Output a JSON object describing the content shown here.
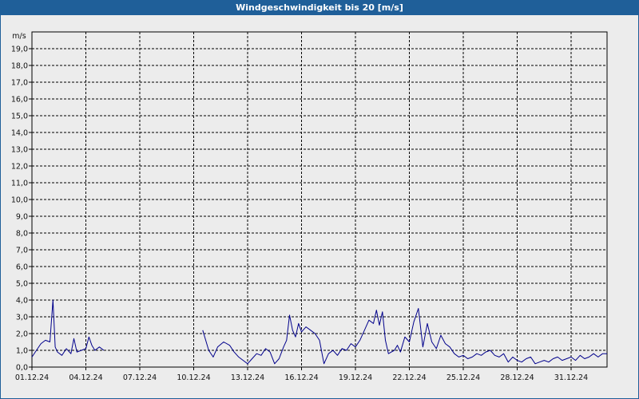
{
  "chart_data": {
    "type": "line",
    "title": "Windgeschwindigkeit bis 20 [m/s]",
    "ylabel": "m/s",
    "xlabel": "",
    "ylim": [
      0,
      20
    ],
    "xlim": [
      "2024-12-01",
      "2025-01-02"
    ],
    "y_ticks": [
      "0,0",
      "1,0",
      "2,0",
      "3,0",
      "4,0",
      "5,0",
      "6,0",
      "7,0",
      "8,0",
      "9,0",
      "10,0",
      "11,0",
      "12,0",
      "13,0",
      "14,0",
      "15,0",
      "16,0",
      "17,0",
      "18,0",
      "19,0"
    ],
    "x_ticks": [
      "01.12.24",
      "04.12.24",
      "07.12.24",
      "10.12.24",
      "13.12.24",
      "16.12.24",
      "19.12.24",
      "22.12.24",
      "25.12.24",
      "28.12.24",
      "31.12.24"
    ],
    "grid": true,
    "line_color": "#00008b",
    "segments": [
      {
        "x": [
          "2024-12-01T00:00",
          "2024-12-01T06:00",
          "2024-12-01T12:00",
          "2024-12-01T18:00",
          "2024-12-02T00:00",
          "2024-12-02T04:00",
          "2024-12-02T07:00",
          "2024-12-02T10:00",
          "2024-12-02T16:00",
          "2024-12-02T22:00",
          "2024-12-03T04:00",
          "2024-12-03T08:00",
          "2024-12-03T12:00",
          "2024-12-03T18:00",
          "2024-12-04T00:00",
          "2024-12-04T04:00",
          "2024-12-04T08:00",
          "2024-12-04T12:00",
          "2024-12-04T18:00",
          "2024-12-05T00:00"
        ],
        "y": [
          0.6,
          1.0,
          1.4,
          1.6,
          1.5,
          4.0,
          1.2,
          0.9,
          0.7,
          1.1,
          0.8,
          1.7,
          0.9,
          1.0,
          1.1,
          1.8,
          1.3,
          1.0,
          1.2,
          1.0
        ]
      },
      {
        "x": [
          "2024-12-10T12:00",
          "2024-12-10T20:00",
          "2024-12-11T02:00",
          "2024-12-11T08:00",
          "2024-12-11T16:00",
          "2024-12-12T00:00",
          "2024-12-12T06:00",
          "2024-12-12T12:00",
          "2024-12-12T18:00",
          "2024-12-13T00:00",
          "2024-12-13T06:00",
          "2024-12-13T12:00",
          "2024-12-13T18:00",
          "2024-12-14T00:00",
          "2024-12-14T06:00",
          "2024-12-14T12:00",
          "2024-12-14T18:00",
          "2024-12-15T00:00",
          "2024-12-15T04:00",
          "2024-12-15T08:00",
          "2024-12-15T12:00",
          "2024-12-15T16:00",
          "2024-12-15T20:00",
          "2024-12-16T00:00",
          "2024-12-16T06:00",
          "2024-12-16T12:00",
          "2024-12-16T18:00",
          "2024-12-17T00:00",
          "2024-12-17T06:00",
          "2024-12-17T12:00",
          "2024-12-17T18:00",
          "2024-12-18T00:00",
          "2024-12-18T06:00",
          "2024-12-18T12:00",
          "2024-12-18T18:00",
          "2024-12-19T00:00",
          "2024-12-19T06:00",
          "2024-12-19T12:00",
          "2024-12-19T18:00",
          "2024-12-20T00:00",
          "2024-12-20T04:00",
          "2024-12-20T08:00",
          "2024-12-20T12:00",
          "2024-12-20T16:00",
          "2024-12-20T20:00",
          "2024-12-21T00:00",
          "2024-12-21T04:00",
          "2024-12-21T08:00",
          "2024-12-21T12:00",
          "2024-12-21T18:00",
          "2024-12-22T00:00",
          "2024-12-22T06:00",
          "2024-12-22T12:00",
          "2024-12-22T18:00",
          "2024-12-23T00:00",
          "2024-12-23T06:00",
          "2024-12-23T12:00",
          "2024-12-23T18:00",
          "2024-12-24T00:00",
          "2024-12-24T06:00",
          "2024-12-24T12:00",
          "2024-12-24T18:00",
          "2024-12-25T00:00",
          "2024-12-25T06:00",
          "2024-12-25T12:00",
          "2024-12-25T18:00",
          "2024-12-26T00:00",
          "2024-12-26T06:00",
          "2024-12-26T12:00",
          "2024-12-26T18:00",
          "2024-12-27T00:00",
          "2024-12-27T06:00",
          "2024-12-27T12:00",
          "2024-12-27T18:00",
          "2024-12-28T00:00",
          "2024-12-28T06:00",
          "2024-12-28T12:00",
          "2024-12-28T18:00",
          "2024-12-29T00:00",
          "2024-12-29T06:00",
          "2024-12-29T12:00",
          "2024-12-29T18:00",
          "2024-12-30T00:00",
          "2024-12-30T06:00",
          "2024-12-30T12:00",
          "2024-12-30T18:00",
          "2024-12-31T00:00",
          "2024-12-31T06:00",
          "2024-12-31T12:00",
          "2024-12-31T18:00",
          "2025-01-01T00:00",
          "2025-01-01T06:00",
          "2025-01-01T12:00",
          "2025-01-01T18:00",
          "2025-01-02T00:00"
        ],
        "y": [
          2.2,
          1.0,
          0.6,
          1.2,
          1.5,
          1.3,
          0.9,
          0.6,
          0.4,
          0.2,
          0.5,
          0.8,
          0.7,
          1.1,
          0.9,
          0.2,
          0.5,
          1.2,
          1.6,
          3.1,
          2.2,
          1.8,
          2.6,
          2.1,
          2.4,
          2.2,
          2.0,
          1.6,
          0.2,
          0.8,
          1.0,
          0.7,
          1.1,
          1.0,
          1.4,
          1.2,
          1.6,
          2.2,
          2.8,
          2.6,
          3.4,
          2.5,
          3.3,
          1.6,
          0.8,
          0.9,
          1.0,
          1.3,
          0.9,
          1.8,
          1.5,
          2.7,
          3.5,
          1.2,
          2.6,
          1.5,
          1.1,
          1.9,
          1.4,
          1.2,
          0.8,
          0.6,
          0.7,
          0.5,
          0.6,
          0.8,
          0.7,
          0.9,
          1.0,
          0.7,
          0.6,
          0.8,
          0.3,
          0.6,
          0.4,
          0.3,
          0.5,
          0.6,
          0.2,
          0.3,
          0.4,
          0.3,
          0.5,
          0.6,
          0.4,
          0.5,
          0.6,
          0.4,
          0.7,
          0.5,
          0.6,
          0.8,
          0.6,
          0.8,
          0.8
        ]
      }
    ]
  }
}
